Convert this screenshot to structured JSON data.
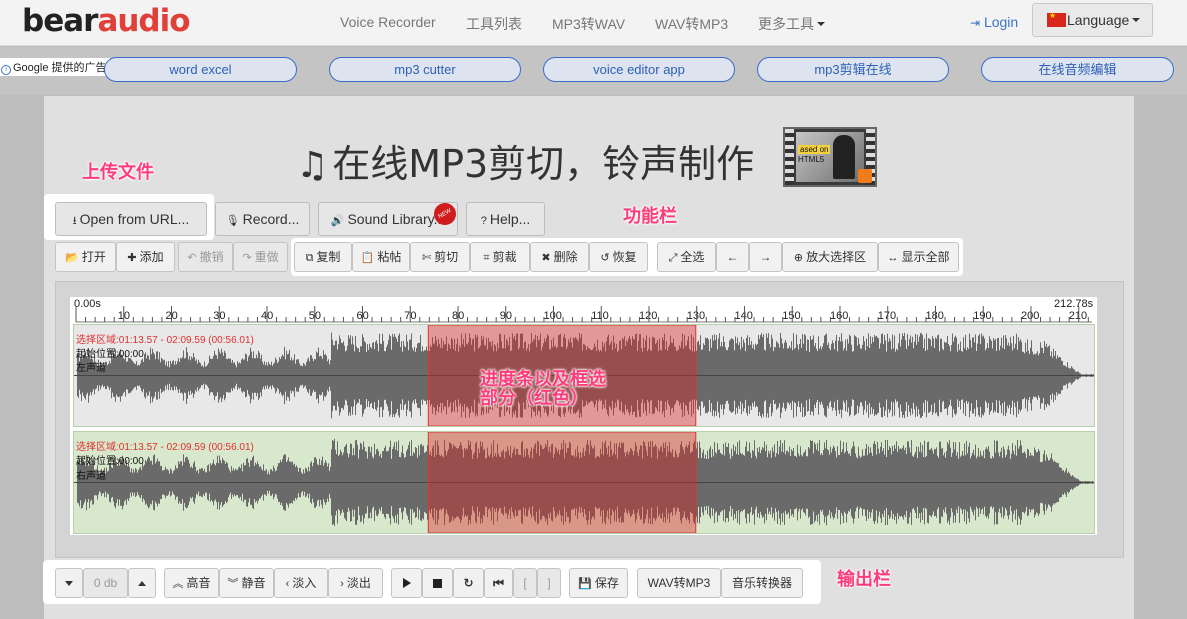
{
  "brand": {
    "part1": "bear",
    "part2": "audio"
  },
  "nav": {
    "items": [
      "Voice Recorder",
      "工具列表",
      "MP3转WAV",
      "WAV转MP3",
      "更多工具"
    ],
    "login": "Login",
    "language": "Language"
  },
  "ads": {
    "label": "Google 提供的广告",
    "links": [
      "word excel",
      "mp3 cutter",
      "voice editor app",
      "mp3剪辑在线",
      "在线音频编辑"
    ]
  },
  "page": {
    "title": "在线MP3剪切，铃声制作",
    "thumb_text": [
      "ased on",
      "HTML5"
    ]
  },
  "annotations": {
    "upload": "上传文件",
    "functions": "功能栏",
    "output": "输出栏",
    "progress_line1": "进度条以及框选",
    "progress_line2": "部分（红色）"
  },
  "top_buttons": {
    "open_url": "Open from URL...",
    "record": "Record...",
    "sound_library": "Sound Library...",
    "new_badge": "NEW",
    "help": "Help..."
  },
  "edit_toolbar": {
    "open": "打开",
    "add": "添加",
    "undo": "撤销",
    "redo": "重做",
    "copy": "复制",
    "paste": "粘帖",
    "cut": "剪切",
    "crop": "剪裁",
    "delete": "删除",
    "restore": "恢复",
    "select_all": "全选",
    "zoom_selection": "放大选择区",
    "show_all": "显示全部"
  },
  "ruler": {
    "start": "0.00s",
    "end": "212.78s",
    "ticks": [
      10,
      20,
      30,
      40,
      50,
      60,
      70,
      80,
      90,
      100,
      110,
      120,
      130,
      140,
      150,
      160,
      170,
      180,
      190,
      200,
      210
    ],
    "duration": 212.78
  },
  "selection": {
    "start_s": 73.57,
    "end_s": 129.59
  },
  "tracks": [
    {
      "selection_text": "选择区域:01:13.57 - 02:09.59 (00:56.01)",
      "start_text": "起始位置:00:00",
      "channel": "左声道"
    },
    {
      "selection_text": "选择区域:01:13.57 - 02:09.59 (00:56.01)",
      "start_text": "起始位置:00:00",
      "channel": "右声道"
    }
  ],
  "bottom_toolbar": {
    "gain_value": "0 db",
    "louder": "高音",
    "mute": "静音",
    "fade_in": "淡入",
    "fade_out": "淡出",
    "mark_in": "[",
    "mark_out": "]",
    "save": "保存",
    "wav_to_mp3": "WAV转MP3",
    "music_converter": "音乐转换器"
  },
  "colors": {
    "accent_red": "#e0403a",
    "link_blue": "#2f5fb6",
    "annotation_pink": "#ff3b7a",
    "selection_red": "#d33",
    "track_green": "#d8e8cc"
  }
}
